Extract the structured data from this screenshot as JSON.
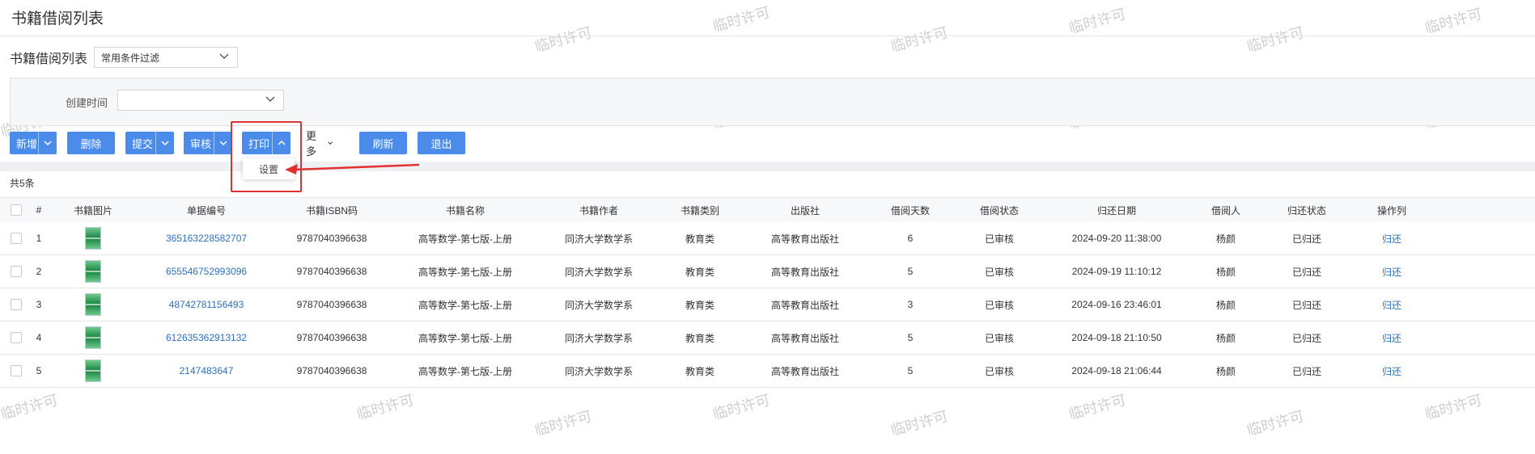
{
  "header": {
    "title": "书籍借阅列表"
  },
  "filter_bar": {
    "label": "书籍借阅列表",
    "filter_select": "常用条件过滤"
  },
  "criteria": {
    "created_time_label": "创建时间",
    "created_time_value": ""
  },
  "toolbar": {
    "add": "新增",
    "delete": "删除",
    "submit": "提交",
    "audit": "审核",
    "print": "打印",
    "more": "更多",
    "refresh": "刷新",
    "exit": "退出"
  },
  "print_menu": {
    "items": [
      "设置"
    ]
  },
  "summary": {
    "count_text": "共5条"
  },
  "colors": {
    "primary": "#4b8bea",
    "link": "#2f6fb8",
    "highlight": "#e03131"
  },
  "watermark": "临时许可",
  "table": {
    "headers": [
      "#",
      "书籍图片",
      "单据编号",
      "书籍ISBN码",
      "书籍名称",
      "书籍作者",
      "书籍类别",
      "出版社",
      "借阅天数",
      "借阅状态",
      "归还日期",
      "借阅人",
      "归还状态",
      "操作列"
    ],
    "rows": [
      {
        "index": "1",
        "image": "book-cover",
        "doc_no": "365163228582707",
        "isbn": "9787040396638",
        "name": "高等数学-第七版-上册",
        "author": "同济大学数学系",
        "category": "教育类",
        "publisher": "高等教育出版社",
        "days": "6",
        "status": "已审核",
        "return_date": "2024-09-20 11:38:00",
        "borrower": "杨颜",
        "return_status": "已归还",
        "action": "归还"
      },
      {
        "index": "2",
        "image": "book-cover",
        "doc_no": "655546752993096",
        "isbn": "9787040396638",
        "name": "高等数学-第七版-上册",
        "author": "同济大学数学系",
        "category": "教育类",
        "publisher": "高等教育出版社",
        "days": "5",
        "status": "已审核",
        "return_date": "2024-09-19 11:10:12",
        "borrower": "杨颜",
        "return_status": "已归还",
        "action": "归还"
      },
      {
        "index": "3",
        "image": "book-cover",
        "doc_no": "48742781156493",
        "isbn": "9787040396638",
        "name": "高等数学-第七版-上册",
        "author": "同济大学数学系",
        "category": "教育类",
        "publisher": "高等教育出版社",
        "days": "3",
        "status": "已审核",
        "return_date": "2024-09-16 23:46:01",
        "borrower": "杨颜",
        "return_status": "已归还",
        "action": "归还"
      },
      {
        "index": "4",
        "image": "book-cover",
        "doc_no": "612635362913132",
        "isbn": "9787040396638",
        "name": "高等数学-第七版-上册",
        "author": "同济大学数学系",
        "category": "教育类",
        "publisher": "高等教育出版社",
        "days": "5",
        "status": "已审核",
        "return_date": "2024-09-18 21:10:50",
        "borrower": "杨颜",
        "return_status": "已归还",
        "action": "归还"
      },
      {
        "index": "5",
        "image": "book-cover",
        "doc_no": "2147483647",
        "isbn": "9787040396638",
        "name": "高等数学-第七版-上册",
        "author": "同济大学数学系",
        "category": "教育类",
        "publisher": "高等教育出版社",
        "days": "5",
        "status": "已审核",
        "return_date": "2024-09-18 21:06:44",
        "borrower": "杨颜",
        "return_status": "已归还",
        "action": "归还"
      }
    ]
  }
}
